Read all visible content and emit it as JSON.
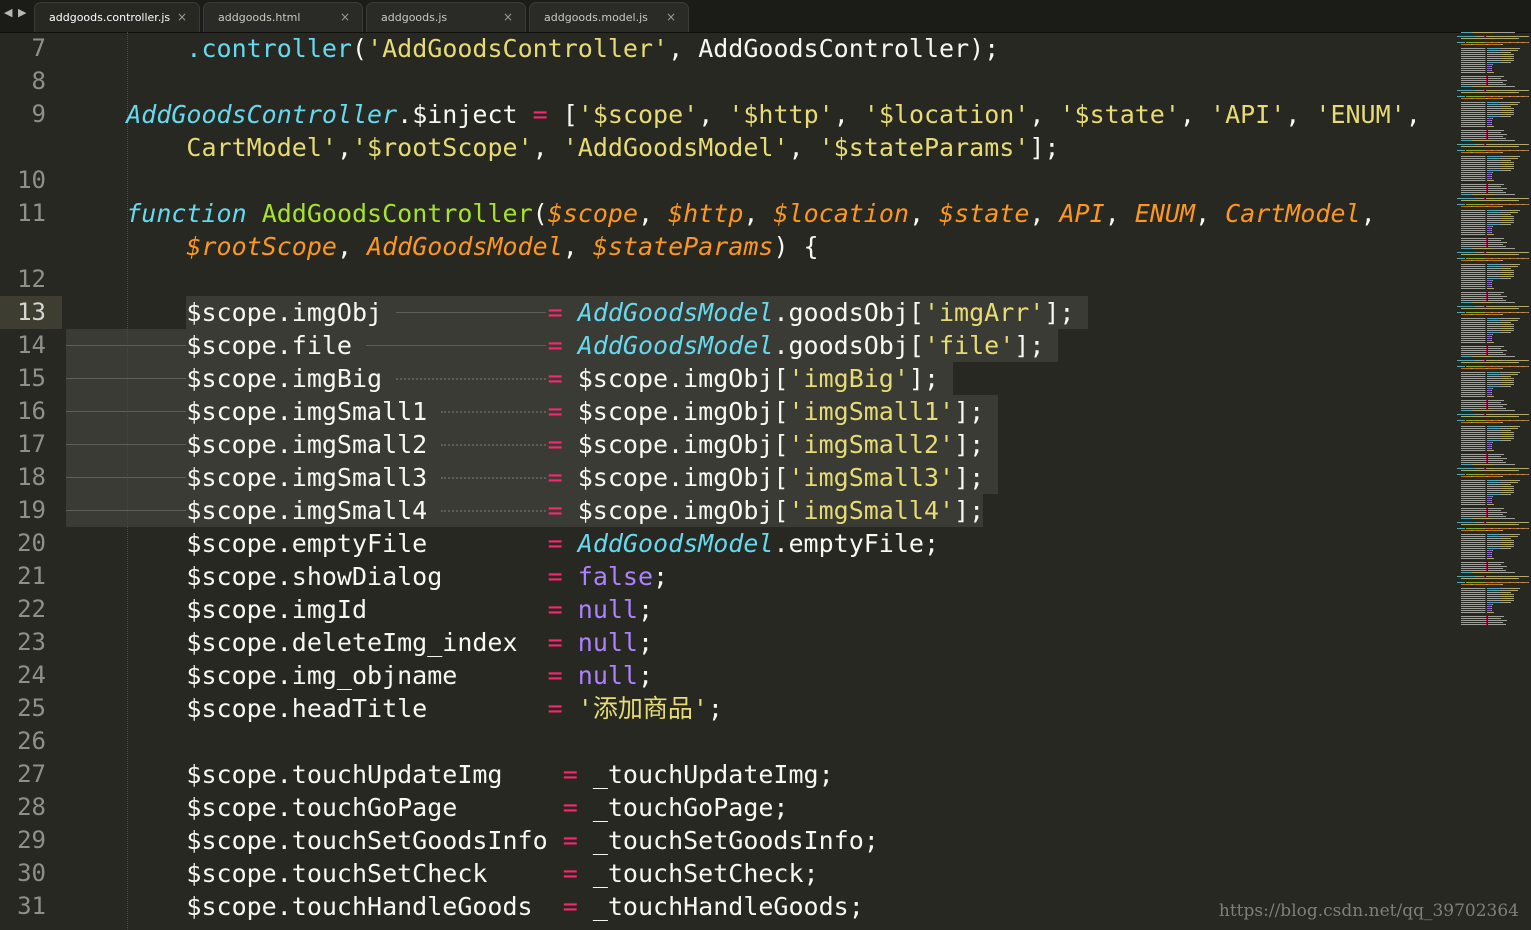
{
  "tabs": [
    {
      "label": "addgoods.controller.js",
      "active": true
    },
    {
      "label": "addgoods.html",
      "active": false
    },
    {
      "label": "addgoods.js",
      "active": false
    },
    {
      "label": "addgoods.model.js",
      "active": false
    }
  ],
  "tab_nav_arrows": "◀ ▶",
  "tab_close_glyph": "×",
  "gutter": {
    "line_numbers": [
      "7",
      "8",
      "9",
      "",
      "10",
      "11",
      "",
      "12",
      "13",
      "14",
      "15",
      "16",
      "17",
      "18",
      "19",
      "20",
      "21",
      "22",
      "23",
      "24",
      "25",
      "26",
      "27",
      "28",
      "29",
      "30",
      "31"
    ],
    "current_line": "13"
  },
  "code": [
    [
      [
        "t",
        "        "
      ],
      [
        "p",
        ".controller"
      ],
      [
        "t",
        "("
      ],
      [
        "s",
        "'AddGoodsController'"
      ],
      [
        "t",
        ", AddGoodsController);"
      ]
    ],
    [],
    [
      [
        "t",
        "    "
      ],
      [
        "c",
        "AddGoodsController"
      ],
      [
        "t",
        ".$inject "
      ],
      [
        "o",
        "="
      ],
      [
        "t",
        " ["
      ],
      [
        "s",
        "'$scope'"
      ],
      [
        "t",
        ", "
      ],
      [
        "s",
        "'$http'"
      ],
      [
        "t",
        ", "
      ],
      [
        "s",
        "'$location'"
      ],
      [
        "t",
        ", "
      ],
      [
        "s",
        "'$state'"
      ],
      [
        "t",
        ", "
      ],
      [
        "s",
        "'API'"
      ],
      [
        "t",
        ", "
      ],
      [
        "s",
        "'ENUM'"
      ],
      [
        "t",
        ", "
      ],
      [
        "s",
        "'"
      ]
    ],
    [
      [
        "t",
        "        "
      ],
      [
        "s",
        "CartModel'"
      ],
      [
        "t",
        ","
      ],
      [
        "s",
        "'$rootScope'"
      ],
      [
        "t",
        ", "
      ],
      [
        "s",
        "'AddGoodsModel'"
      ],
      [
        "t",
        ", "
      ],
      [
        "s",
        "'$stateParams'"
      ],
      [
        "t",
        "];"
      ]
    ],
    [],
    [
      [
        "t",
        "    "
      ],
      [
        "k",
        "function"
      ],
      [
        "t",
        " "
      ],
      [
        "f",
        "AddGoodsController"
      ],
      [
        "t",
        "("
      ],
      [
        "a",
        "$scope"
      ],
      [
        "t",
        ", "
      ],
      [
        "a",
        "$http"
      ],
      [
        "t",
        ", "
      ],
      [
        "a",
        "$location"
      ],
      [
        "t",
        ", "
      ],
      [
        "a",
        "$state"
      ],
      [
        "t",
        ", "
      ],
      [
        "a",
        "API"
      ],
      [
        "t",
        ", "
      ],
      [
        "a",
        "ENUM"
      ],
      [
        "t",
        ", "
      ],
      [
        "a",
        "CartModel"
      ],
      [
        "t",
        ","
      ]
    ],
    [
      [
        "t",
        "        "
      ],
      [
        "a",
        "$rootScope"
      ],
      [
        "t",
        ", "
      ],
      [
        "a",
        "AddGoodsModel"
      ],
      [
        "t",
        ", "
      ],
      [
        "a",
        "$stateParams"
      ],
      [
        "t",
        ") {"
      ]
    ],
    [],
    [
      [
        "t",
        "        $scope.imgObj           "
      ],
      [
        "o",
        "="
      ],
      [
        "t",
        " "
      ],
      [
        "c",
        "AddGoodsModel"
      ],
      [
        "t",
        ".goodsObj["
      ],
      [
        "s",
        "'imgArr'"
      ],
      [
        "t",
        "];"
      ]
    ],
    [
      [
        "t",
        "        $scope.file             "
      ],
      [
        "o",
        "="
      ],
      [
        "t",
        " "
      ],
      [
        "c",
        "AddGoodsModel"
      ],
      [
        "t",
        ".goodsObj["
      ],
      [
        "s",
        "'file'"
      ],
      [
        "t",
        "];"
      ]
    ],
    [
      [
        "t",
        "        $scope.imgBig           "
      ],
      [
        "o",
        "="
      ],
      [
        "t",
        " $scope.imgObj["
      ],
      [
        "s",
        "'imgBig'"
      ],
      [
        "t",
        "];"
      ]
    ],
    [
      [
        "t",
        "        $scope.imgSmall1        "
      ],
      [
        "o",
        "="
      ],
      [
        "t",
        " $scope.imgObj["
      ],
      [
        "s",
        "'imgSmall1'"
      ],
      [
        "t",
        "];"
      ]
    ],
    [
      [
        "t",
        "        $scope.imgSmall2        "
      ],
      [
        "o",
        "="
      ],
      [
        "t",
        " $scope.imgObj["
      ],
      [
        "s",
        "'imgSmall2'"
      ],
      [
        "t",
        "];"
      ]
    ],
    [
      [
        "t",
        "        $scope.imgSmall3        "
      ],
      [
        "o",
        "="
      ],
      [
        "t",
        " $scope.imgObj["
      ],
      [
        "s",
        "'imgSmall3'"
      ],
      [
        "t",
        "];"
      ]
    ],
    [
      [
        "t",
        "        $scope.imgSmall4        "
      ],
      [
        "o",
        "="
      ],
      [
        "t",
        " $scope.imgObj["
      ],
      [
        "s",
        "'imgSmall4'"
      ],
      [
        "t",
        "];"
      ]
    ],
    [
      [
        "t",
        "        $scope.emptyFile        "
      ],
      [
        "o",
        "="
      ],
      [
        "t",
        " "
      ],
      [
        "c",
        "AddGoodsModel"
      ],
      [
        "t",
        ".emptyFile;"
      ]
    ],
    [
      [
        "t",
        "        $scope.showDialog       "
      ],
      [
        "o",
        "="
      ],
      [
        "t",
        " "
      ],
      [
        "b",
        "false"
      ],
      [
        "t",
        ";"
      ]
    ],
    [
      [
        "t",
        "        $scope.imgId            "
      ],
      [
        "o",
        "="
      ],
      [
        "t",
        " "
      ],
      [
        "b",
        "null"
      ],
      [
        "t",
        ";"
      ]
    ],
    [
      [
        "t",
        "        $scope.deleteImg_index  "
      ],
      [
        "o",
        "="
      ],
      [
        "t",
        " "
      ],
      [
        "b",
        "null"
      ],
      [
        "t",
        ";"
      ]
    ],
    [
      [
        "t",
        "        $scope.img_objname      "
      ],
      [
        "o",
        "="
      ],
      [
        "t",
        " "
      ],
      [
        "b",
        "null"
      ],
      [
        "t",
        ";"
      ]
    ],
    [
      [
        "t",
        "        $scope.headTitle        "
      ],
      [
        "o",
        "="
      ],
      [
        "t",
        " "
      ],
      [
        "s",
        "'添加商品'"
      ],
      [
        "t",
        ";"
      ]
    ],
    [],
    [
      [
        "t",
        "        $scope.touchUpdateImg    "
      ],
      [
        "o",
        "="
      ],
      [
        "t",
        " _touchUpdateImg;"
      ]
    ],
    [
      [
        "t",
        "        $scope.touchGoPage       "
      ],
      [
        "o",
        "="
      ],
      [
        "t",
        " _touchGoPage;"
      ]
    ],
    [
      [
        "t",
        "        $scope.touchSetGoodsInfo "
      ],
      [
        "o",
        "="
      ],
      [
        "t",
        " _touchSetGoodsInfo;"
      ]
    ],
    [
      [
        "t",
        "        $scope.touchSetCheck     "
      ],
      [
        "o",
        "="
      ],
      [
        "t",
        " _touchSetCheck;"
      ]
    ],
    [
      [
        "t",
        "        $scope.touchHandleGoods  "
      ],
      [
        "o",
        "="
      ],
      [
        "t",
        " _touchHandleGoods;"
      ]
    ]
  ],
  "watermark": "https://blog.csdn.net/qq_39702364",
  "colors": {
    "background": "#272822",
    "plain": "#f8f8f2",
    "string": "#e6db74",
    "operator": "#f92672",
    "keyword": "#66d9ef",
    "function_name": "#a6e22e",
    "parameter": "#fd971f",
    "constant": "#ae81ff",
    "line_number": "#90908a"
  }
}
